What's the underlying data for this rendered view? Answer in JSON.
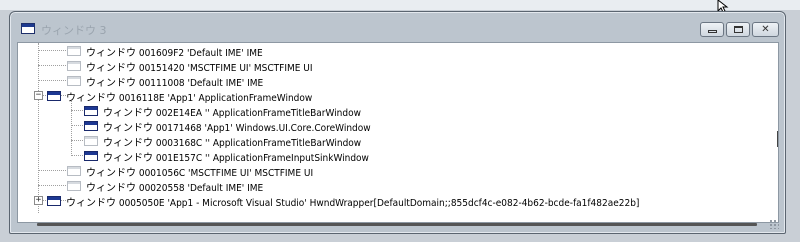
{
  "window": {
    "title": "ウィンドウ 3"
  },
  "caption": {
    "minimize": "",
    "maximize": "",
    "close": "✕"
  },
  "tree": {
    "rows": [
      {
        "text": "ウィンドウ 001609F2 'Default IME' IME",
        "icon": "inactive"
      },
      {
        "text": "ウィンドウ 00151420 'MSCTFIME UI' MSCTFIME UI",
        "icon": "inactive"
      },
      {
        "text": "ウィンドウ 00111008 'Default IME' IME",
        "icon": "inactive"
      },
      {
        "text": "ウィンドウ 0016118E 'App1' ApplicationFrameWindow",
        "icon": "active",
        "expander": "−"
      },
      {
        "text": "ウィンドウ 002E14EA '' ApplicationFrameTitleBarWindow",
        "icon": "active"
      },
      {
        "text": "ウィンドウ 00171468 'App1' Windows.UI.Core.CoreWindow",
        "icon": "active"
      },
      {
        "text": "ウィンドウ 0003168C '' ApplicationFrameTitleBarWindow",
        "icon": "inactive"
      },
      {
        "text": "ウィンドウ 001E157C '' ApplicationFrameInputSinkWindow",
        "icon": "active"
      },
      {
        "text": "ウィンドウ 0001056C 'MSCTFIME UI' MSCTFIME UI",
        "icon": "inactive"
      },
      {
        "text": "ウィンドウ 00020558 'Default IME' IME",
        "icon": "inactive"
      },
      {
        "text": "ウィンドウ 0005050E 'App1 - Microsoft Visual Studio' HwndWrapper[DefaultDomain;;855dcf4c-e082-4b62-bcde-fa1f482ae22b]",
        "icon": "active",
        "expander": "+"
      }
    ]
  }
}
